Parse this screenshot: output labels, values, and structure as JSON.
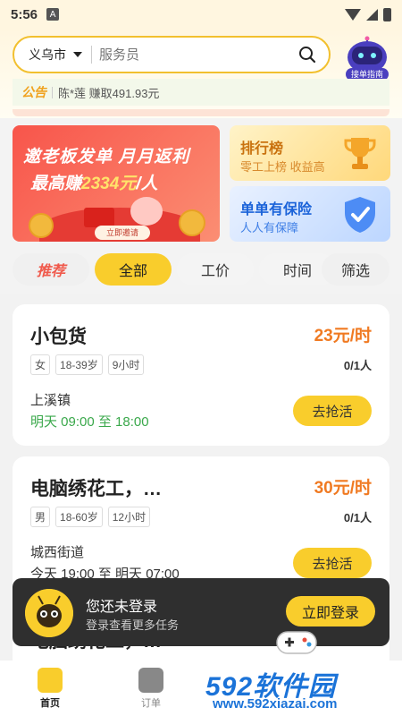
{
  "status_bar": {
    "time": "5:56",
    "notif": "A"
  },
  "search": {
    "city": "义乌市",
    "placeholder": "服务员"
  },
  "robot": {
    "label": "接单指南"
  },
  "notice": {
    "tag": "公告",
    "text": "陈*莲 赚取491.93元"
  },
  "banners": {
    "main": {
      "line1": "邀老板发单 月月返利",
      "line2_prefix": "最高赚",
      "line2_amount": "2334元",
      "line2_suffix": "/人",
      "cta": "立即邀请"
    },
    "rank": {
      "title": "排行榜",
      "subtitle": "零工上榜 收益高"
    },
    "insurance": {
      "title": "单单有保险",
      "subtitle": "人人有保障"
    }
  },
  "tabs": [
    {
      "label": "推荐"
    },
    {
      "label": "全部"
    },
    {
      "label": "工价"
    },
    {
      "label": "时间"
    },
    {
      "label": "筛选"
    }
  ],
  "jobs": [
    {
      "title": "小包货",
      "wage": "23元/时",
      "tags": [
        "女",
        "18-39岁",
        "9小时"
      ],
      "quota": "0/1人",
      "location": "上溪镇",
      "time": "明天 09:00 至 18:00",
      "action": "去抢活"
    },
    {
      "title": "电脑绣花工，…",
      "wage": "30元/时",
      "tags": [
        "男",
        "18-60岁",
        "12小时"
      ],
      "quota": "0/1人",
      "location": "城西街道",
      "time": "今天 19:00 至 明天 07:00",
      "action": "去抢活"
    },
    {
      "title": "电脑绣花工，…"
    }
  ],
  "login_bar": {
    "title": "您还未登录",
    "subtitle": "登录查看更多任务",
    "button": "立即登录"
  },
  "nav": {
    "items": [
      {
        "label": "首页"
      },
      {
        "label": "订单"
      }
    ]
  },
  "watermark": {
    "logo_num": "592",
    "logo_cn": "软件园",
    "url": "www.592xiazai.com"
  },
  "colors": {
    "accent": "#f9cd2c",
    "wage": "#f07a22",
    "green": "#3aa84b",
    "brand_blue": "#1b73d8"
  }
}
